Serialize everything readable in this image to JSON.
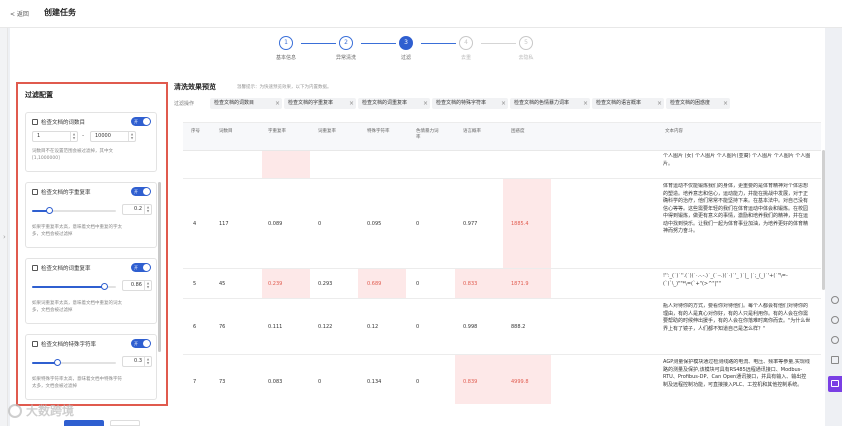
{
  "header": {
    "back_label": "< 返回",
    "title": "创建任务"
  },
  "steps": [
    {
      "num": "1",
      "label": "基本信息",
      "state": "done"
    },
    {
      "num": "2",
      "label": "异常清洗",
      "state": "done"
    },
    {
      "num": "3",
      "label": "过滤",
      "state": "active"
    },
    {
      "num": "4",
      "label": "去重",
      "state": "todo"
    },
    {
      "num": "5",
      "label": "去隐私",
      "state": "todo"
    }
  ],
  "filter_panel": {
    "title": "过滤配置",
    "cards": [
      {
        "label": "检查文档的词数目",
        "toggle": "开",
        "min_value": "1",
        "max_value": "10000",
        "range_dash": "-",
        "desc_lines": [
          "词数目不在设置范围会被过滤掉，其中文",
          "[1,1000000]"
        ]
      },
      {
        "label": "检查文档的字重复率",
        "toggle": "开",
        "value": "0.2",
        "level": 0.2,
        "desc_lines": [
          "如果字重复率太高，意味着文档中重复的字太",
          "多，文档会被过滤掉"
        ]
      },
      {
        "label": "检查文档的词重复率",
        "toggle": "开",
        "value": "0.86",
        "level": 0.86,
        "desc_lines": [
          "如果词重复率太高，意味着文档中重复的词太",
          "多，文档会被过滤掉"
        ]
      },
      {
        "label": "检查文档的特殊字符率",
        "toggle": "开",
        "value": "0.3",
        "level": 0.3,
        "desc_lines": [
          "如果特殊字符率太高，意味着文档中特殊字符",
          "太多，文档会被过滤掉"
        ]
      }
    ]
  },
  "preview": {
    "title": "清洗效果预览",
    "hint": "温馨提示：为快速预览效果，以下为内置数据。",
    "ops_label": "过滤操作",
    "tags": [
      "检查文档的词数目",
      "检查文档的字重复率",
      "检查文档的词重复率",
      "检查文档的特殊字符率",
      "检查文档的色情暴力词率",
      "检查文档的语言概率",
      "检查文档的困惑度"
    ]
  },
  "table": {
    "headers": [
      "序号",
      "词数目",
      "字重复率",
      "词重复率",
      "特殊字符率",
      "色情暴力词率",
      "语言概率",
      "困惑度",
      "文本内容"
    ],
    "partial_row": {
      "content": "个人图片 (女) 个人图片 个人图片(亚裔) 个人图片 个人图片 个人图片。"
    },
    "rows": [
      {
        "id": "4",
        "words": "117",
        "char_rep": "0.089",
        "word_rep": "0",
        "special": "0.095",
        "porn": "0",
        "lang": "0.977",
        "ppl": "1885.4",
        "content": "体育运动不仅能锻炼我们的身体，更重要的是体育精神对个体思想的塑造。培养意志和信心，运动能力，并能在挑战中发展，对于正确科学的治疗，他们常常不能坚持下来。在基本法中。对自己没有信心等等。这些需要年轻的我们在体育运动中体会和锻炼。在校园中得到锻炼，做更有意义的事情，激励和培养我们的精神，并在运动中找到快乐。让我们一起为体育事业加油，为培养更好的体育精神而努力奋斗。"
      },
      {
        "id": "5",
        "words": "45",
        "char_rep": "0.239",
        "word_rep": "0.293",
        "special": "0.689",
        "porn": "0",
        "lang": "0.833",
        "ppl": "1871.9",
        "content": "!'':_(`)`''.(`)(`·.-.-.)`_(`·-.)(`·)`'_ )`|_ |`;_(_)`'+(`\"\\=-(`)`\\_)\"\"*\\=(`+\"(>^\"|\"\""
      },
      {
        "id": "6",
        "words": "76",
        "char_rep": "0.111",
        "word_rep": "0.122",
        "special": "0.12",
        "porn": "0",
        "lang": "0.998",
        "ppl": "888.2",
        "content": "瓶人对待你的方式，要看你对待他们。每个人都会有他们对待你的理由，有的人是真心对你好，有的人只是利用你。有的人会在你需要帮助的时候伸出援手，有的人会在你落难时离你而去。\"为什么世界上有了镜子，人们都不知道自己是怎么样？\""
      },
      {
        "id": "7",
        "words": "73",
        "char_rep": "0.083",
        "word_rep": "0",
        "special": "0.134",
        "porn": "0",
        "lang": "0.839",
        "ppl": "4999.8",
        "content": "AGP测量保护模块通过检测线路的电流、电压、频率等参量,实现线路的测量及保护,该模块可具有RS485远程通讯接口、Modbus-RTU、Profibus-DP、Can Open通讯接口，并具有输入、输出控制及远程控制功能，可直接接入PLC、工控机和其他控制系统。"
      }
    ]
  },
  "watermark": "大数跨境",
  "colors": {
    "accent": "#2f5fd0",
    "highlight_border": "#e05a4e",
    "bad_value": "#e05a4e",
    "bad_bg": "#fde8e8",
    "chat": "#7a3fe4"
  }
}
